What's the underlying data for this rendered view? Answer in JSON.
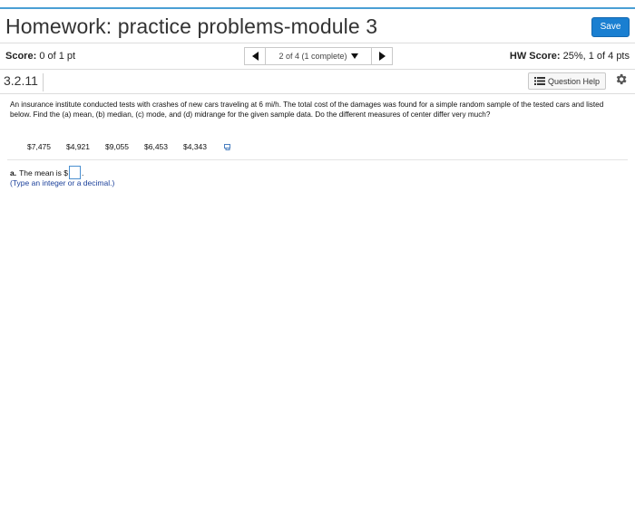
{
  "header": {
    "title": "Homework: practice problems-module 3",
    "save_label": "Save"
  },
  "score_bar": {
    "score_label": "Score:",
    "score_value": "0 of 1 pt",
    "nav_text": "2 of 4 (1 complete)",
    "hw_score_label": "HW Score:",
    "hw_score_value": "25%, 1 of 4 pts"
  },
  "question": {
    "number": "3.2.11",
    "help_label": "Question Help",
    "text": "An insurance institute conducted tests with crashes of new cars traveling at 6 mi/h. The total cost of the damages was found for a simple random sample of the tested cars and listed below. Find the (a) mean, (b) median, (c) mode, and (d) midrange for the given sample data. Do the different measures of center differ very much?",
    "values": [
      "$7,475",
      "$4,921",
      "$9,055",
      "$6,453",
      "$4,343"
    ]
  },
  "answer": {
    "part_label": "a.",
    "prompt_prefix": "The mean is $",
    "prompt_suffix": ".",
    "input_value": "",
    "hint": "(Type an integer or a decimal.)"
  },
  "colors": {
    "accent": "#1a7fd1",
    "top_line": "#4a9fd4",
    "hint_text": "#1a3f9a"
  },
  "icons": [
    "list-icon",
    "gear-icon",
    "copy-icon",
    "arrow-left-icon",
    "arrow-right-icon",
    "caret-down-icon"
  ]
}
